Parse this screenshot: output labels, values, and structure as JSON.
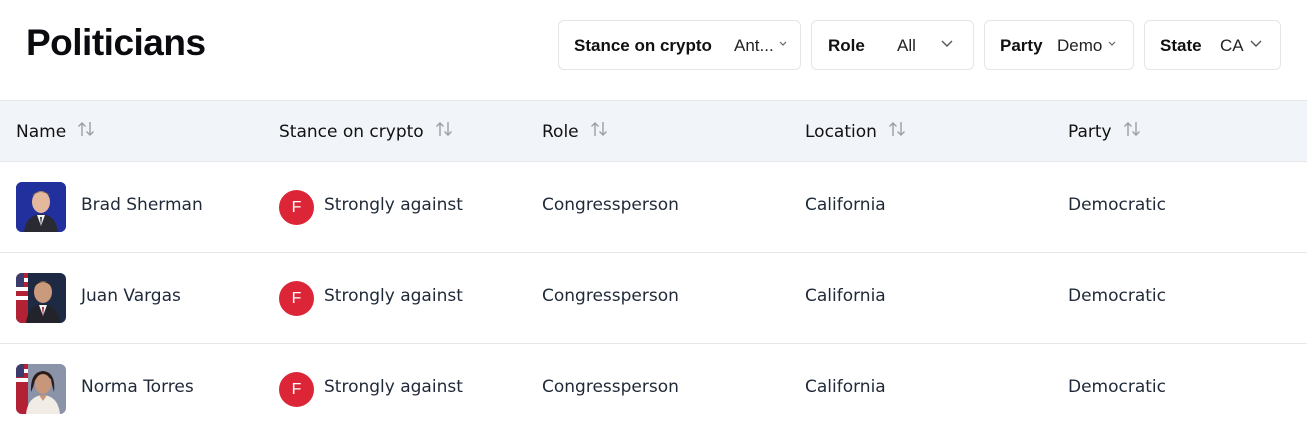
{
  "page": {
    "title": "Politicians"
  },
  "filters": [
    {
      "label": "Stance on crypto",
      "value": "Ant..."
    },
    {
      "label": "Role",
      "value": "All"
    },
    {
      "label": "Party",
      "value": "Demo"
    },
    {
      "label": "State",
      "value": "CA"
    }
  ],
  "table": {
    "columns": [
      "Name",
      "Stance on crypto",
      "Role",
      "Location",
      "Party"
    ],
    "rows": [
      {
        "name": "Brad Sherman",
        "grade": "F",
        "stance": "Strongly against",
        "role": "Congressperson",
        "location": "California",
        "party": "Democratic"
      },
      {
        "name": "Juan Vargas",
        "grade": "F",
        "stance": "Strongly against",
        "role": "Congressperson",
        "location": "California",
        "party": "Democratic"
      },
      {
        "name": "Norma Torres",
        "grade": "F",
        "stance": "Strongly against",
        "role": "Congressperson",
        "location": "California",
        "party": "Democratic"
      }
    ]
  },
  "colors": {
    "grade_f": "#dc2637",
    "header_bg": "#f1f4f8",
    "border": "#e5e7eb"
  },
  "icons": {
    "sort": "sort-arrows-icon",
    "chevron": "chevron-down-icon"
  }
}
